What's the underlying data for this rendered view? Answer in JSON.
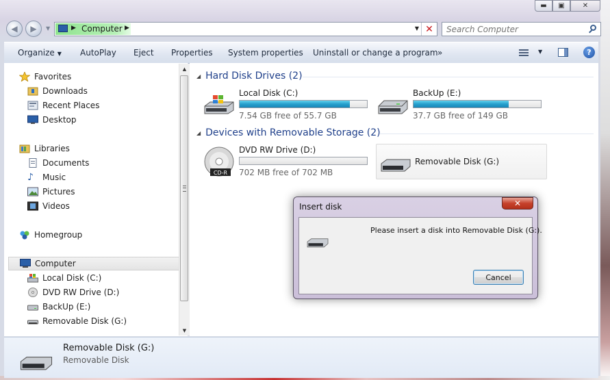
{
  "window": {
    "controls": {
      "minimize": "▬",
      "maximize": "▣",
      "close": "✕"
    }
  },
  "address_bar": {
    "location": "Computer",
    "search_placeholder": "Search Computer"
  },
  "command_bar": {
    "items": [
      "Organize",
      "AutoPlay",
      "Eject",
      "Properties",
      "System properties",
      "Uninstall or change a program"
    ],
    "overflow": "»"
  },
  "nav_pane": {
    "favorites": {
      "label": "Favorites",
      "items": [
        "Downloads",
        "Recent Places",
        "Desktop"
      ]
    },
    "libraries": {
      "label": "Libraries",
      "items": [
        "Documents",
        "Music",
        "Pictures",
        "Videos"
      ]
    },
    "homegroup": "Homegroup",
    "computer": {
      "label": "Computer",
      "items": [
        "Local Disk (C:)",
        "DVD RW Drive (D:)",
        "BackUp (E:)",
        "Removable Disk (G:)"
      ]
    }
  },
  "content": {
    "groups": [
      {
        "title": "Hard Disk Drives (2)",
        "drives": [
          {
            "name": "Local Disk (C:)",
            "free": "7.54 GB free of 55.7 GB",
            "used_fraction": 0.865
          },
          {
            "name": "BackUp (E:)",
            "free": "37.7 GB free of 149 GB",
            "used_fraction": 0.747
          }
        ]
      },
      {
        "title": "Devices with Removable Storage (2)",
        "drives": [
          {
            "name": "DVD RW Drive (D:)",
            "free": "702 MB free of 702 MB",
            "used_fraction": 0.0,
            "media_label": "CD-R"
          },
          {
            "name": "Removable Disk (G:)"
          }
        ]
      }
    ]
  },
  "details_pane": {
    "name": "Removable Disk (G:)",
    "type": "Removable Disk"
  },
  "dialog": {
    "title": "Insert disk",
    "message": "Please insert a disk into Removable Disk (G:).",
    "cancel_label": "Cancel",
    "close_glyph": "✕"
  },
  "colors": {
    "bar_fill": "#26a0cd",
    "group_header": "#1e3f8a",
    "dialog_close": "#c6412b"
  }
}
